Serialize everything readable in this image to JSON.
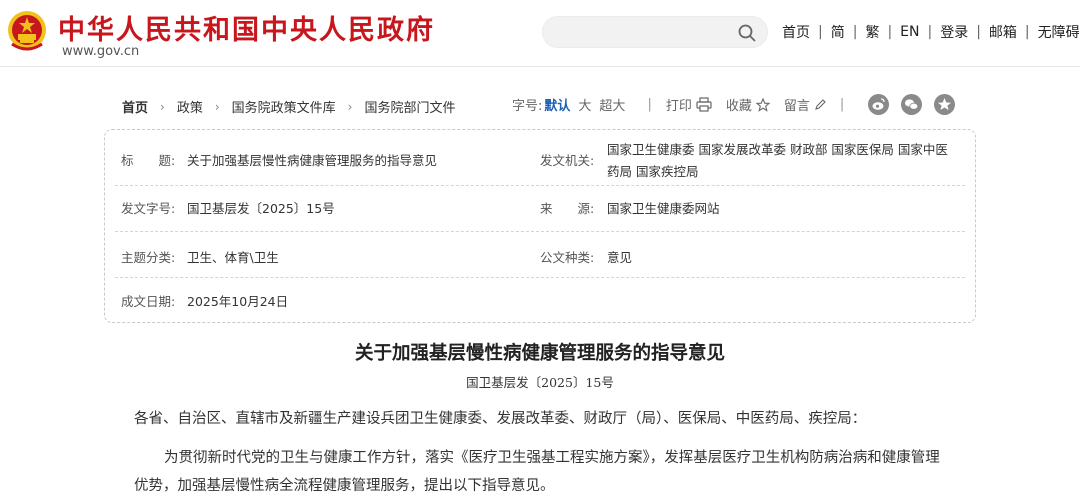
{
  "header": {
    "site_title": "中华人民共和国中央人民政府",
    "site_url": "www.gov.cn",
    "search_placeholder": "",
    "nav": [
      {
        "label": "首页"
      },
      {
        "label": "简"
      },
      {
        "label": "繁"
      },
      {
        "label": "EN"
      },
      {
        "label": "登录"
      },
      {
        "label": "邮箱"
      },
      {
        "label": "无障碍"
      }
    ],
    "nav_separator": "|"
  },
  "breadcrumb": [
    {
      "label": "首页"
    },
    {
      "label": "政策"
    },
    {
      "label": "国务院政策文件库"
    },
    {
      "label": "国务院部门文件"
    }
  ],
  "toolbar": {
    "font_size_label": "字号:",
    "font_sizes": [
      "默认",
      "大",
      "超大"
    ],
    "active_font_size": "默认",
    "print_label": "打印",
    "favorite_label": "收藏",
    "comment_label": "留言",
    "separator": "|",
    "share_icons": [
      "weibo-icon",
      "wechat-icon",
      "qzone-icon"
    ]
  },
  "info": {
    "title_label": "标　　题:",
    "title_value": "关于加强基层慢性病健康管理服务的指导意见",
    "issuer_label": "发文机关:",
    "issuer_line1": "国家卫生健康委  国家发展改革委  财政部  国家医保局  国家中医",
    "issuer_line2": "药局  国家疾控局",
    "docno_label": "发文字号:",
    "docno_value": "国卫基层发〔2025〕15号",
    "source_label": "来　　源:",
    "source_value": "国家卫生健康委网站",
    "category_label": "主题分类:",
    "category_value": "卫生、体育\\卫生",
    "doctype_label": "公文种类:",
    "doctype_value": "意见",
    "date_label": "成文日期:",
    "date_value": "2025年10月24日"
  },
  "article": {
    "title": "关于加强基层慢性病健康管理服务的指导意见",
    "doc_no": "国卫基层发〔2025〕15号",
    "para1": "各省、自治区、直辖市及新疆生产建设兵团卫生健康委、发展改革委、财政厅（局）、医保局、中医药局、疾控局：",
    "para2": "为贯彻新时代党的卫生与健康工作方针，落实《医疗卫生强基工程实施方案》，发挥基层医疗卫生机构防病治病和健康管理优势，加强基层慢性病全流程健康管理服务，提出以下指导意见。"
  },
  "colors": {
    "brand_red": "#c8161d",
    "emblem_gold": "#f2c11a",
    "active_blue": "#1a5fb4"
  }
}
